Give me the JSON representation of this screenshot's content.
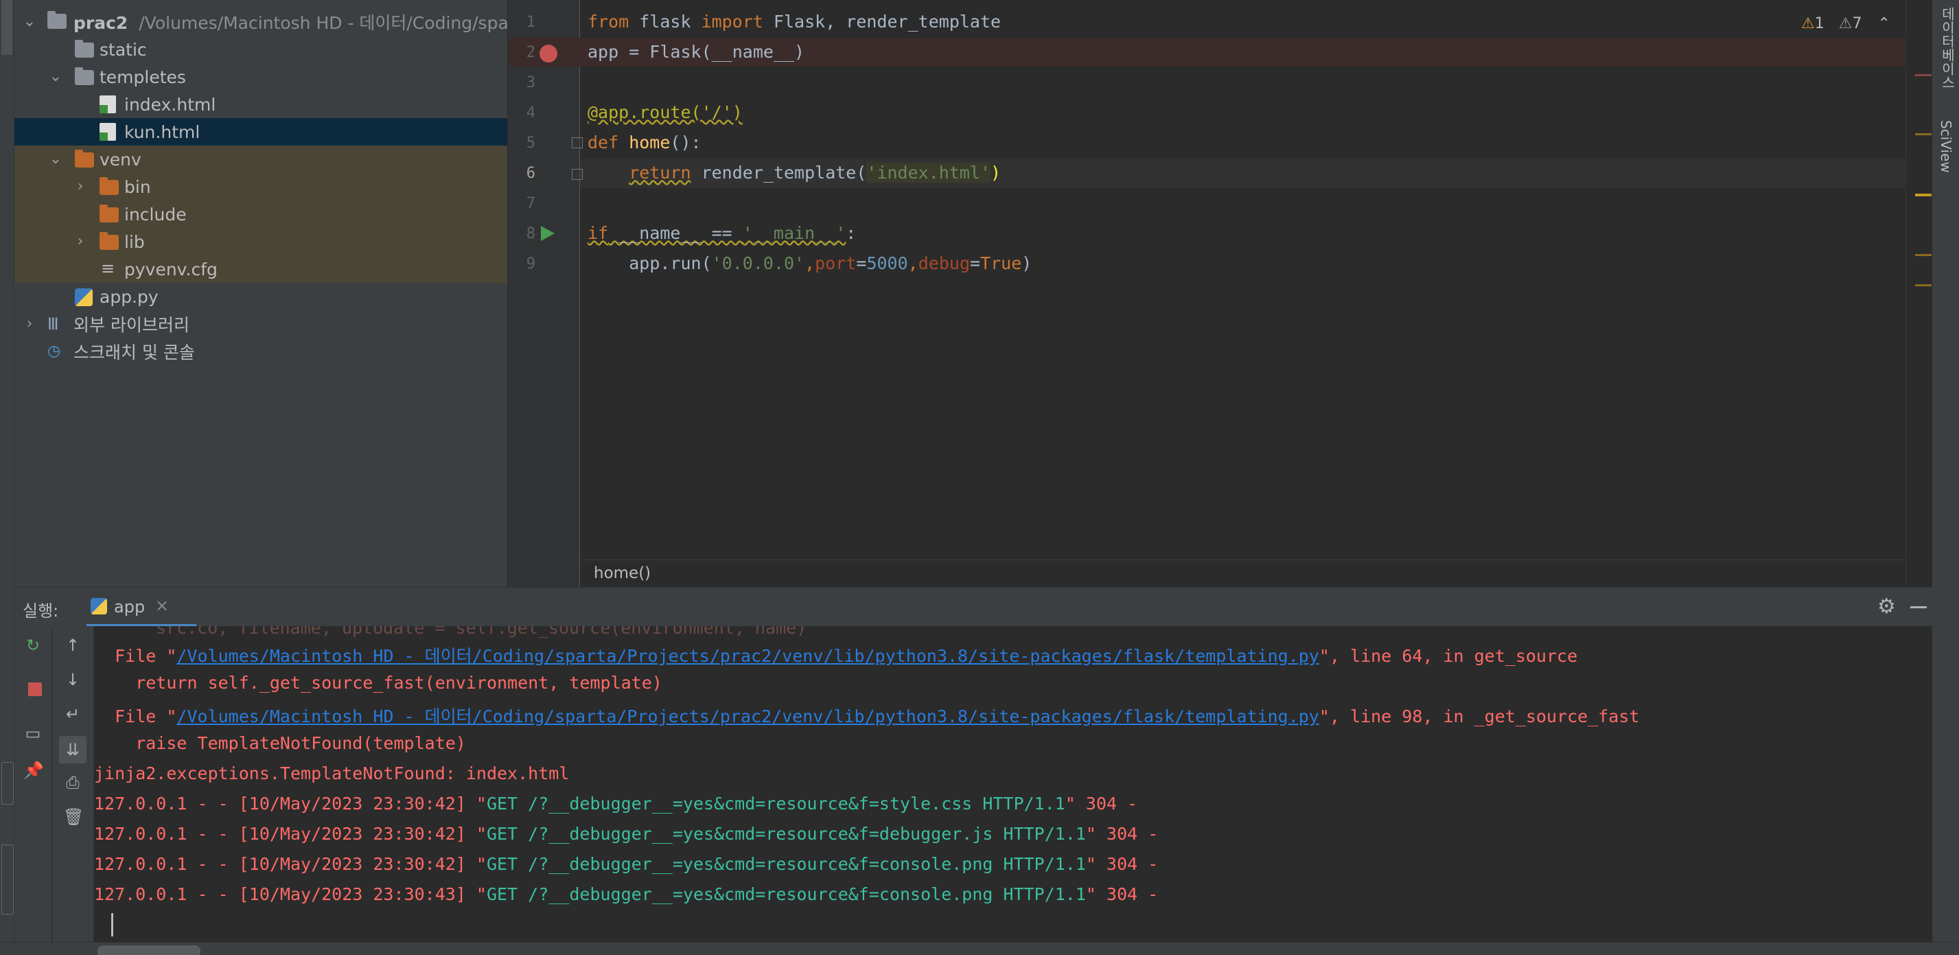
{
  "project": {
    "root_name": "prac2",
    "root_path": "/Volumes/Macintosh HD - 데이터/Coding/spar",
    "items": [
      {
        "label": "static"
      },
      {
        "label": "templetes"
      },
      {
        "label": "index.html"
      },
      {
        "label": "kun.html"
      },
      {
        "label": "venv"
      },
      {
        "label": "bin"
      },
      {
        "label": "include"
      },
      {
        "label": "lib"
      },
      {
        "label": "pyvenv.cfg"
      },
      {
        "label": "app.py"
      },
      {
        "label": "외부 라이브러리"
      },
      {
        "label": "스크래치 및 콘솔"
      }
    ]
  },
  "editor": {
    "line_numbers": [
      "1",
      "2",
      "3",
      "4",
      "5",
      "6",
      "7",
      "8",
      "9"
    ],
    "lines": {
      "l1_kw1": "from",
      "l1_mod": " flask ",
      "l1_kw2": "import",
      "l1_rest": " Flask, render_template",
      "l2": "app = Flask(__name__)",
      "l4": "@app.route('/')",
      "l5_kw": "def",
      "l5_fn": " home",
      "l5_rest": "():",
      "l6_kw": "return",
      "l6_call": " render_template(",
      "l6_str": "'index.html'",
      "l6_end": ")",
      "l8_kw": "if",
      "l8_cond": " __name__ == ",
      "l8_str": "'__main__'",
      "l8_end": ":",
      "l9_obj": "app.run(",
      "l9_str": "'0.0.0.0'",
      "l9_c1": ",",
      "l9_p1": "port",
      "l9_eq1": "=",
      "l9_num": "5000",
      "l9_c2": ",",
      "l9_p2": "debug",
      "l9_eq2": "=",
      "l9_true": "True",
      "l9_end": ")"
    },
    "breadcrumb": "home()",
    "inspections": {
      "warn_count": "1",
      "weak_warn_count": "7"
    }
  },
  "right_strip": {
    "db_label": "데이터베이스",
    "sciview_label": "SciView"
  },
  "run": {
    "label": "실행:",
    "tab_label": "app",
    "console": {
      "file1_pre": "  File \"",
      "file1_path": "/Volumes/Macintosh HD - 데이터/Coding/sparta/Projects/prac2/venv/lib/python3.8/site-packages/flask/templating.py",
      "file1_post": "\", line 64, in get_source",
      "line_a": "    return self._get_source_fast(environment, template)",
      "file2_pre": "  File \"",
      "file2_path": "/Volumes/Macintosh HD - 데이터/Coding/sparta/Projects/prac2/venv/lib/python3.8/site-packages/flask/templating.py",
      "file2_post": "\", line 98, in _get_source_fast",
      "line_b": "    raise TemplateNotFound(template)",
      "exception": "jinja2.exceptions.TemplateNotFound: index.html",
      "log": [
        {
          "prefix": "127.0.0.1 - - [10/May/2023 23:30:42] \"",
          "req": "GET /?__debugger__=yes&cmd=resource&f=style.css HTTP/1.1",
          "suffix": "\" 304 -"
        },
        {
          "prefix": "127.0.0.1 - - [10/May/2023 23:30:42] \"",
          "req": "GET /?__debugger__=yes&cmd=resource&f=debugger.js HTTP/1.1",
          "suffix": "\" 304 -"
        },
        {
          "prefix": "127.0.0.1 - - [10/May/2023 23:30:42] \"",
          "req": "GET /?__debugger__=yes&cmd=resource&f=console.png HTTP/1.1",
          "suffix": "\" 304 -"
        },
        {
          "prefix": "127.0.0.1 - - [10/May/2023 23:30:43] \"",
          "req": "GET /?__debugger__=yes&cmd=resource&f=console.png HTTP/1.1",
          "suffix": "\" 304 -"
        }
      ]
    }
  },
  "icons": [
    "chevron-down-icon",
    "chevron-right-icon",
    "folder-icon",
    "html-file-icon",
    "python-file-icon",
    "breakpoint-icon",
    "run-gutter-icon",
    "rerun-icon",
    "stop-icon",
    "up-arrow-icon",
    "down-arrow-icon",
    "soft-wrap-icon",
    "scroll-end-icon",
    "print-icon",
    "trash-icon",
    "pin-icon",
    "gear-icon",
    "minimize-icon"
  ],
  "colors": {
    "error": "#ff6b68",
    "link": "#287bde",
    "selection": "#0d293e",
    "venv_bg": "#4b4536",
    "keyword": "#cc7832",
    "string": "#6a8759"
  }
}
